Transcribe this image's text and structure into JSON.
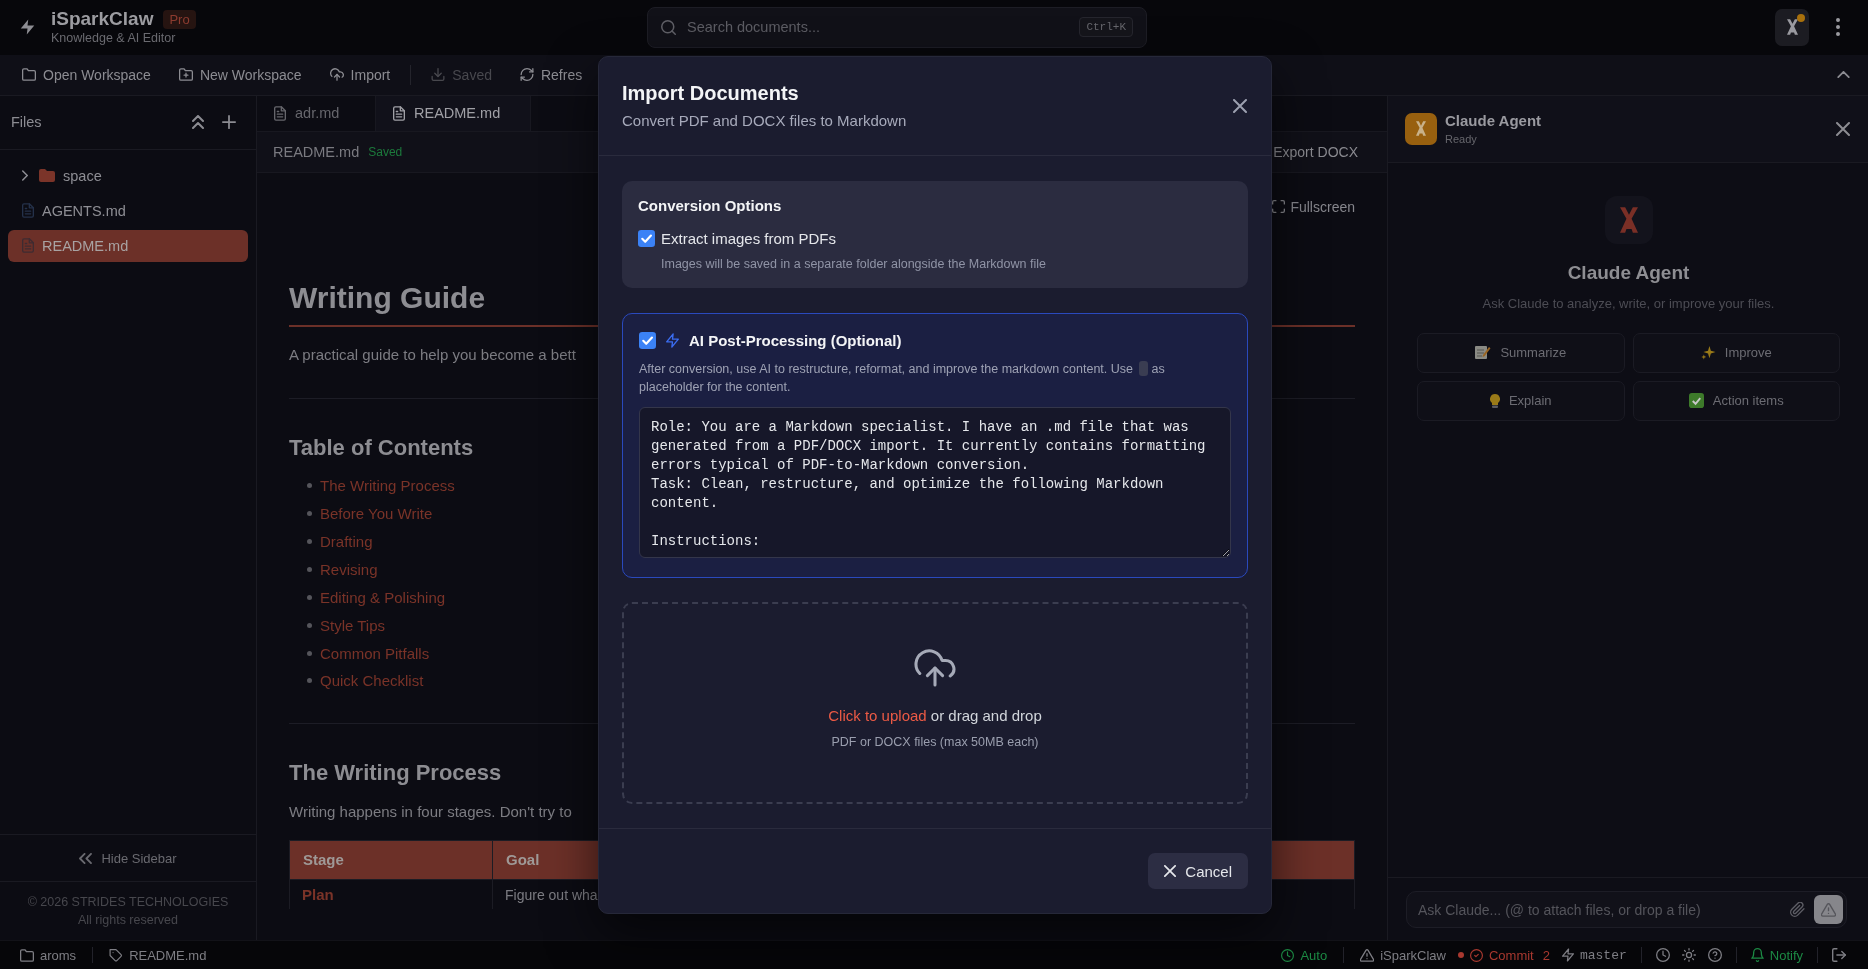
{
  "header": {
    "brand": "iSparkClaw",
    "badge": "Pro",
    "subtitle": "Knowledge & AI Editor",
    "search": {
      "placeholder": "Search documents...",
      "shortcut": "Ctrl+K"
    },
    "agent_notification": true
  },
  "toolbar": {
    "items": [
      {
        "kind": "open",
        "label": "Open Workspace",
        "disabled": false
      },
      {
        "kind": "new",
        "label": "New Workspace",
        "disabled": false
      },
      {
        "kind": "import",
        "label": "Import",
        "disabled": false
      },
      {
        "kind": "save",
        "label": "Saved",
        "disabled": true
      },
      {
        "kind": "refresh",
        "label": "Refres",
        "disabled": false
      }
    ]
  },
  "sidebar": {
    "title": "Files",
    "files": [
      {
        "kind": "folder",
        "name": "space",
        "expanded": false,
        "selected": false
      },
      {
        "kind": "file",
        "name": "AGENTS.md",
        "selected": false
      },
      {
        "kind": "file",
        "name": "README.md",
        "selected": true
      }
    ],
    "hide_label": "Hide Sidebar",
    "copyright": "© 2026 STRIDES TECHNOLOGIES",
    "rights": "All rights reserved"
  },
  "editor": {
    "tabs": [
      {
        "label": "adr.md",
        "selected": false
      },
      {
        "label": "README.md",
        "selected": true
      }
    ],
    "file_name": "README.md",
    "save_status": "Saved",
    "export_label": "Export DOCX",
    "fullscreen_label": "Fullscreen",
    "document": {
      "title": "Writing Guide",
      "intro": "A practical guide to help you become a bett",
      "toc_heading": "Table of Contents",
      "toc": [
        "The Writing Process",
        "Before You Write",
        "Drafting",
        "Revising",
        "Editing & Polishing",
        "Style Tips",
        "Common Pitfalls",
        "Quick Checklist"
      ],
      "section_heading": "The Writing Process",
      "section_text": "Writing happens in four stages. Don't try to",
      "table": {
        "columns": [
          "Stage",
          "Goal"
        ],
        "rows": [
          [
            "Plan",
            "Figure out wha"
          ]
        ]
      }
    }
  },
  "agent_panel": {
    "name": "Claude Agent",
    "status": "Ready",
    "title": "Claude Agent",
    "subtitle": "Ask Claude to analyze, write, or improve your files.",
    "actions": [
      {
        "kind": "summarize",
        "label": "Summarize"
      },
      {
        "kind": "improve",
        "label": "Improve"
      },
      {
        "kind": "explain",
        "label": "Explain"
      },
      {
        "kind": "action_items",
        "label": "Action items"
      }
    ],
    "input": {
      "placeholder": "Ask Claude... (@ to attach files, or drop a file)"
    }
  },
  "status_bar": {
    "left": [
      {
        "kind": "workspace",
        "label": "aroms"
      },
      {
        "kind": "file",
        "label": "README.md"
      }
    ],
    "right": [
      {
        "kind": "auto",
        "label": "Auto",
        "color": "#1c8a44"
      },
      {
        "kind": "repo",
        "label": "iSparkClaw"
      },
      {
        "kind": "commit",
        "label": "Commit",
        "count": "2",
        "color": "#a8382f"
      },
      {
        "kind": "branch",
        "label": "master"
      },
      {
        "kind": "notify",
        "label": "Notify",
        "color": "#1c8a44"
      }
    ]
  },
  "import_dialog": {
    "title": "Import Documents",
    "subtitle": "Convert PDF and DOCX files to Markdown",
    "options": {
      "title": "Conversion Options",
      "extract_images": {
        "label": "Extract images from PDFs",
        "checked": true,
        "hint": "Images will be saved in a separate folder alongside the Markdown file"
      }
    },
    "ai_processing": {
      "label": "AI Post-Processing (Optional)",
      "checked": true,
      "description_parts": [
        "After conversion, use AI to restructure, reformat, and improve the markdown content. Use",
        "as placeholder for the content."
      ],
      "prompt": "Role: You are a Markdown specialist. I have an .md file that was generated from a PDF/DOCX import. It currently contains formatting errors typical of PDF-to-Markdown conversion.\nTask: Clean, restructure, and optimize the following Markdown content.\n\nInstructions:"
    },
    "upload": {
      "link": "Click to upload",
      "text": "or drag and drop",
      "hint": "PDF or DOCX files (max 50MB each)"
    },
    "cancel_label": "Cancel"
  }
}
